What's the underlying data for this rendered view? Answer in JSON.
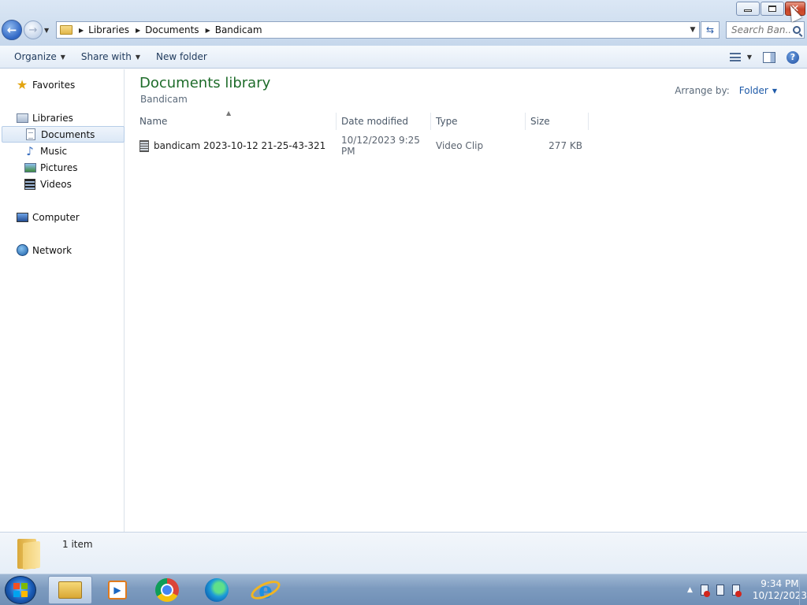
{
  "window": {
    "minimize_icon": "minimize-icon",
    "maximize_icon": "restore-icon",
    "close_icon": "close-icon"
  },
  "address": {
    "crumbs": [
      "Libraries",
      "Documents",
      "Bandicam"
    ],
    "search_placeholder": "Search Ban..."
  },
  "toolbar": {
    "organize": "Organize",
    "share_with": "Share with",
    "new_folder": "New folder"
  },
  "navpane": {
    "favorites": "Favorites",
    "libraries": "Libraries",
    "documents": "Documents",
    "music": "Music",
    "pictures": "Pictures",
    "videos": "Videos",
    "computer": "Computer",
    "network": "Network"
  },
  "content": {
    "title": "Documents library",
    "subtitle": "Bandicam",
    "arrange_label": "Arrange by:",
    "arrange_value": "Folder",
    "columns": [
      "Name",
      "Date modified",
      "Type",
      "Size"
    ],
    "files": [
      {
        "name": "bandicam 2023-10-12 21-25-43-321",
        "date": "10/12/2023 9:25 PM",
        "type": "Video Clip",
        "size": "277 KB"
      }
    ]
  },
  "details": {
    "count": "1 item"
  },
  "taskbar": {
    "time": "9:34 PM",
    "date": "10/12/2023"
  },
  "colors": {
    "library_title": "#1e6c2a",
    "link_blue": "#1e5aa8"
  }
}
